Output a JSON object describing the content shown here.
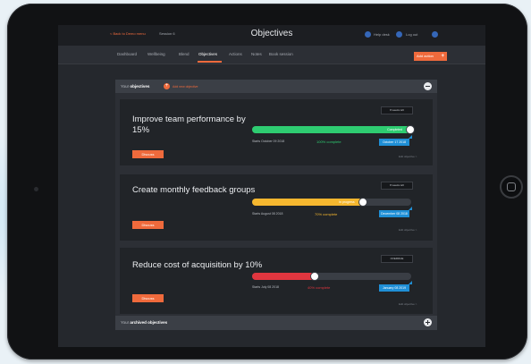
{
  "topbar": {
    "back_link": "< Back to Demo menu",
    "session": "Session 6",
    "title": "Objectives",
    "help": "Help desk",
    "logout": "Log out"
  },
  "nav": {
    "items": [
      "Dashboard",
      "Wellbeing",
      "Blend",
      "Objectives",
      "Actions",
      "Notes",
      "Book session"
    ],
    "active": "Objectives",
    "add_action": "Add action"
  },
  "objectives_panel": {
    "label_prefix": "Your",
    "label_bold": "objectives",
    "add_label": "Add new objective",
    "archived_prefix": "Your",
    "archived_bold": "archived objectives"
  },
  "objectives": [
    {
      "title": "Improve team performance by 15%",
      "tag": "8 weeks left",
      "progress": 1.0,
      "bar_text": "Completed",
      "bar_color": "#2ecc71",
      "started": "Starts October 09 2018",
      "complete": "100% complete",
      "complete_color": "#2ecc71",
      "end": "October 17 2018",
      "edit": "Edit objective >",
      "discuss": "Discuss"
    },
    {
      "title": "Create monthly feedback groups",
      "tag": "8 weeks left",
      "progress": 0.7,
      "bar_text": "In progress",
      "bar_color": "#f5b72f",
      "started": "Starts August 08 2018",
      "complete": "70% complete",
      "complete_color": "#f5b72f",
      "end": "December 08 2018",
      "edit": "Edit objective >",
      "discuss": "Discuss"
    },
    {
      "title": "Reduce cost of acquisition by 10%",
      "tag": "OVERDUE",
      "progress": 0.4,
      "bar_text": "",
      "bar_color": "#e0363f",
      "started": "Starts July 08 2018",
      "complete": "40% complete",
      "complete_color": "#e0363f",
      "end": "January 08 2019",
      "edit": "Edit objective >",
      "discuss": "Discuss"
    }
  ]
}
